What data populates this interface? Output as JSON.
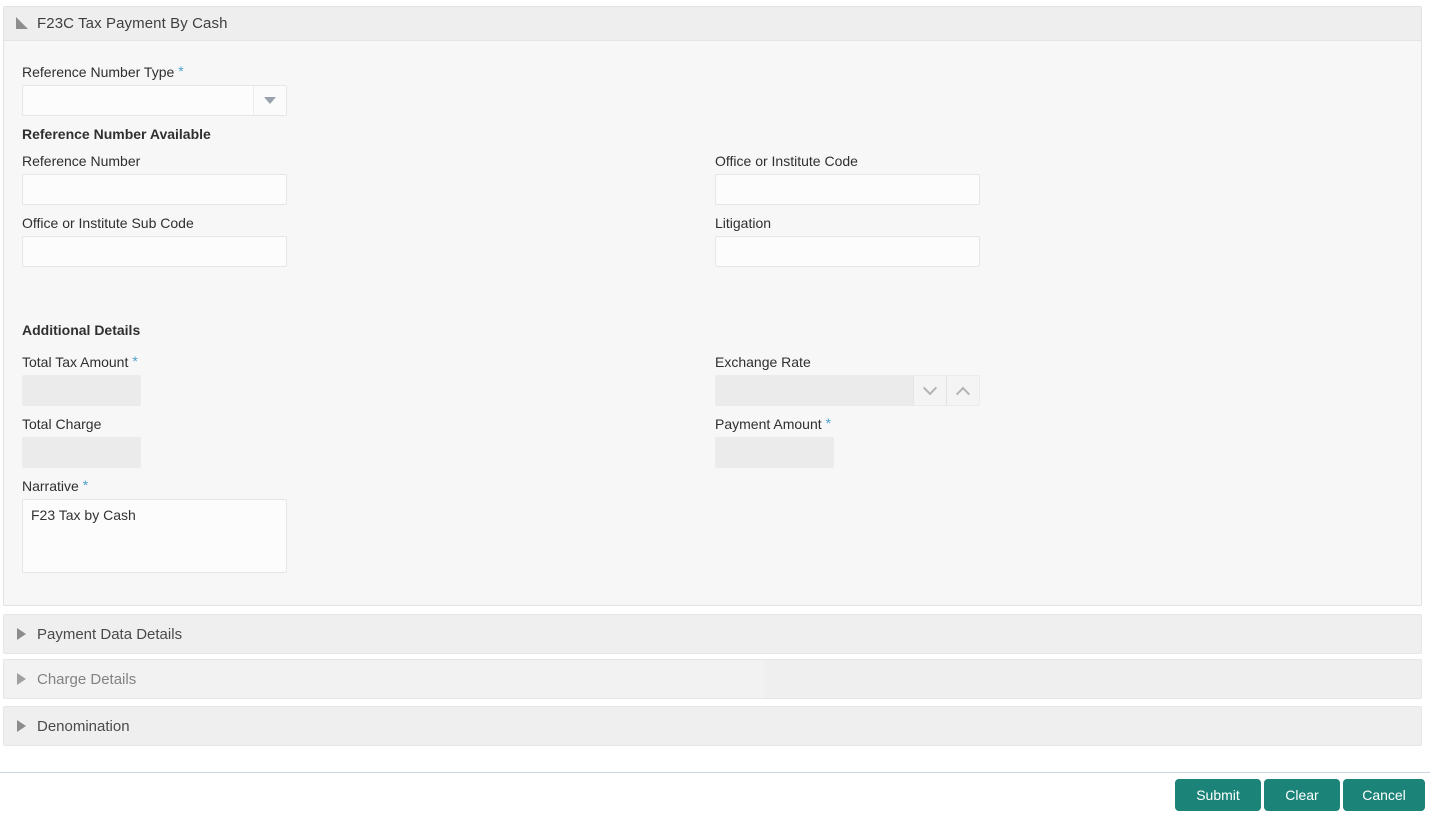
{
  "panel": {
    "title": "F23C Tax Payment By Cash",
    "collapse_icon": "triangle-expanded-icon"
  },
  "form": {
    "reference_number_type": {
      "label": "Reference Number Type",
      "required_marker": "*",
      "value": "",
      "dropdown_icon": "caret-down-icon"
    },
    "reference_number_available_heading": "Reference Number Available",
    "reference_number": {
      "label": "Reference Number",
      "value": ""
    },
    "office_or_institute_code": {
      "label": "Office or Institute Code",
      "value": ""
    },
    "office_or_institute_sub_code": {
      "label": "Office or Institute Sub Code",
      "value": ""
    },
    "litigation": {
      "label": "Litigation",
      "value": ""
    },
    "additional_details_heading": "Additional Details",
    "total_tax_amount": {
      "label": "Total Tax Amount",
      "required_marker": "*",
      "value": ""
    },
    "exchange_rate": {
      "label": "Exchange Rate",
      "value": "",
      "decrement_icon": "chevron-down-icon",
      "increment_icon": "chevron-up-icon"
    },
    "total_charge": {
      "label": "Total Charge",
      "value": ""
    },
    "payment_amount": {
      "label": "Payment Amount",
      "required_marker": "*",
      "value": ""
    },
    "narrative": {
      "label": "Narrative",
      "required_marker": "*",
      "value": "F23 Tax by Cash"
    }
  },
  "accordions": [
    {
      "label": "Payment Data Details",
      "expand_icon": "triangle-collapsed-icon"
    },
    {
      "label": "Charge Details",
      "expand_icon": "triangle-collapsed-icon"
    },
    {
      "label": "Denomination",
      "expand_icon": "triangle-collapsed-icon"
    }
  ],
  "footer": {
    "submit_label": "Submit",
    "clear_label": "Clear",
    "cancel_label": "Cancel",
    "button_color": "#1b8378"
  }
}
